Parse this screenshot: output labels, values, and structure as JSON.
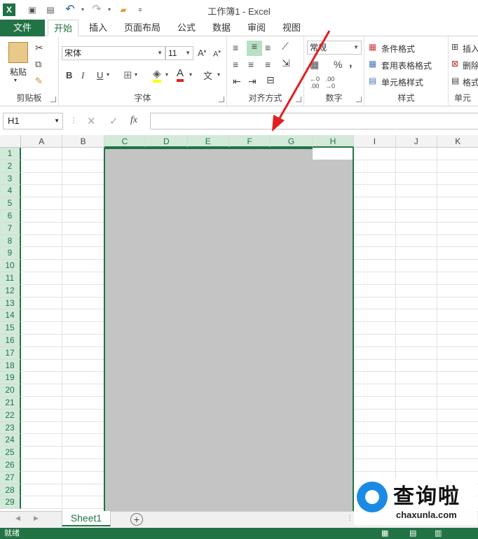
{
  "window": {
    "title": "工作簿1 - Excel"
  },
  "tabs": [
    "文件",
    "开始",
    "插入",
    "页面布局",
    "公式",
    "数据",
    "审阅",
    "视图"
  ],
  "ribbon": {
    "clipboard": {
      "label": "剪贴板",
      "paste": "粘贴"
    },
    "font": {
      "label": "字体",
      "name": "宋体",
      "size": "11",
      "bold": "B",
      "italic": "I",
      "underline": "U"
    },
    "alignment": {
      "label": "对齐方式"
    },
    "number": {
      "label": "数字",
      "format": "常规",
      "percent": "%",
      "comma": ","
    },
    "styles": {
      "label": "样式",
      "conditional": "条件格式",
      "table": "套用表格格式",
      "cell": "单元格样式"
    },
    "cells": {
      "label": "单元",
      "insert": "插入",
      "delete": "删除",
      "format": "格式"
    }
  },
  "formula_bar": {
    "name_box": "H1",
    "fx": "fx",
    "value": ""
  },
  "columns": [
    "A",
    "B",
    "C",
    "D",
    "E",
    "F",
    "G",
    "H",
    "I",
    "J",
    "K"
  ],
  "rows": [
    "1",
    "2",
    "3",
    "4",
    "5",
    "6",
    "7",
    "8",
    "9",
    "10",
    "11",
    "12",
    "13",
    "14",
    "15",
    "16",
    "17",
    "18",
    "19",
    "20",
    "21",
    "22",
    "23",
    "24",
    "25",
    "26",
    "27",
    "28",
    "29"
  ],
  "selected_columns": [
    "C",
    "D",
    "E",
    "F",
    "G",
    "H"
  ],
  "sheets": {
    "active": "Sheet1"
  },
  "status": {
    "text": "就绪"
  },
  "watermark": {
    "title": "查询啦",
    "url": "chaxunla.com"
  },
  "colors": {
    "accent": "#217346",
    "arrow": "#e02020",
    "selection": "#c4c4c4"
  }
}
